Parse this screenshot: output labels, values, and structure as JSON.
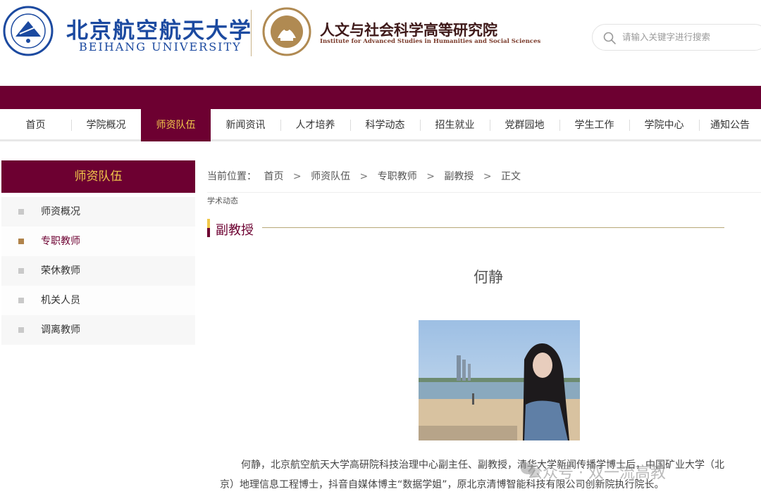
{
  "header": {
    "university_cn": "北京航空航天大学",
    "university_en": "BEIHANG UNIVERSITY",
    "institute_cn": "人文与社会科学高等研究院",
    "institute_en": "Institute for Advanced Studies in Humanities and Social Sciences"
  },
  "search": {
    "placeholder": "请输入关键字进行搜索",
    "icon": "search-icon"
  },
  "nav": {
    "items": [
      {
        "label": "首页"
      },
      {
        "label": "学院概况"
      },
      {
        "label": "师资队伍"
      },
      {
        "label": "新闻资讯"
      },
      {
        "label": "人才培养"
      },
      {
        "label": "科学动态"
      },
      {
        "label": "招生就业"
      },
      {
        "label": "党群园地"
      },
      {
        "label": "学生工作"
      },
      {
        "label": "学院中心"
      },
      {
        "label": "通知公告"
      }
    ],
    "active_label": "师资队伍"
  },
  "sidebar": {
    "title": "师资队伍",
    "items": [
      {
        "label": "师资概况"
      },
      {
        "label": "专职教师"
      },
      {
        "label": "荣休教师"
      },
      {
        "label": "机关人员"
      },
      {
        "label": "调离教师"
      }
    ],
    "active_label": "专职教师"
  },
  "breadcrumb": {
    "prefix": "当前位置：",
    "items": [
      "首页",
      "师资队伍",
      "专职教师",
      "副教授",
      "正文"
    ],
    "separator": ">"
  },
  "content": {
    "sub_label": "学术动态",
    "section_title": "副教授",
    "person_name": "何静",
    "bio_line1": "何静，北京航空航天大学高研院科技治理中心副主任、副教授，清华大学新闻传播学博士后，中国矿业大学（北",
    "bio_line2": "京）地理信息工程博士，抖音自媒体博主“数据学姐”，原北京清博智能科技有限公司创新院执行院长。"
  },
  "watermark": {
    "text": "公众号 · 双一流高教"
  },
  "colors": {
    "brand_maroon": "#6d0031",
    "nav_active_text": "#f1c84b",
    "buaa_blue": "#1c4aa0"
  }
}
